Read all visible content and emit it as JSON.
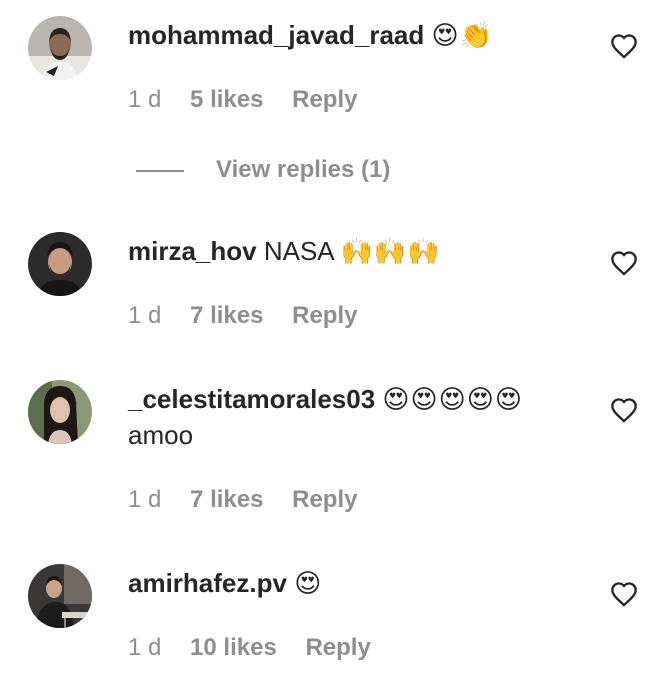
{
  "comments": [
    {
      "username": "mohammad_javad_raad",
      "text": "",
      "emojis": "😍👏",
      "text_line2": "",
      "time": "1 d",
      "likes": "5 likes",
      "reply": "Reply",
      "avatar_icon": "avatar-man-beard",
      "heart_icon": "heart-outline-icon"
    },
    {
      "username": "mirza_hov",
      "text": "NASA",
      "emojis": "🙌🙌🙌",
      "text_line2": "",
      "time": "1 d",
      "likes": "7 likes",
      "reply": "Reply",
      "avatar_icon": "avatar-man-beard-dark",
      "heart_icon": "heart-outline-icon"
    },
    {
      "username": "_celestitamorales03",
      "text": "",
      "emojis": "😍😍😍😍😍",
      "text_line2": "amoo",
      "time": "1 d",
      "likes": "7 likes",
      "reply": "Reply",
      "avatar_icon": "avatar-woman-dark-hair",
      "heart_icon": "heart-outline-icon"
    },
    {
      "username": "amirhafez.pv",
      "text": "",
      "emojis": "😍",
      "text_line2": "",
      "time": "1 d",
      "likes": "10 likes",
      "reply": "Reply",
      "avatar_icon": "avatar-man-studio",
      "heart_icon": "heart-outline-icon"
    }
  ],
  "view_replies": {
    "label": "View replies (1)"
  },
  "colors": {
    "text": "#262626",
    "secondary": "#8e8e8e",
    "background": "#ffffff"
  }
}
